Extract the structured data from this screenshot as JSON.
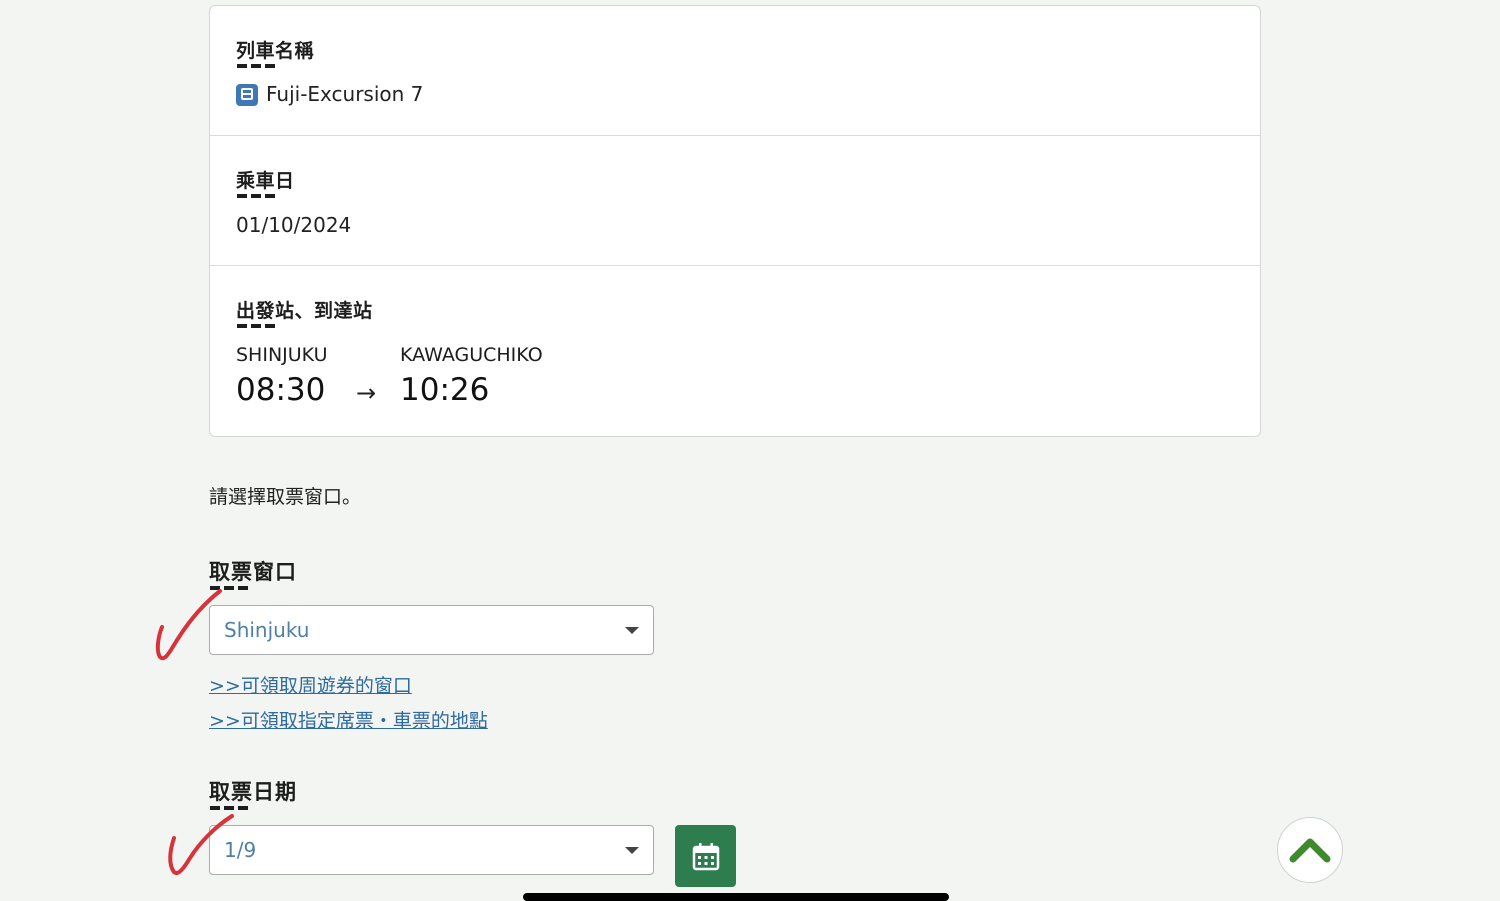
{
  "ticket_card": {
    "train": {
      "label": "列車名稱",
      "name": "Fuji-Excursion 7",
      "icon": "train-icon"
    },
    "date": {
      "label": "乘車日",
      "value": "01/10/2024"
    },
    "route": {
      "label": "出發站、到達站",
      "departure_station": "SHINJUKU",
      "departure_time": "08:30",
      "arrow": "→",
      "arrival_station": "KAWAGUCHIKO",
      "arrival_time": "10:26"
    }
  },
  "instruction": "請選擇取票窗口。",
  "pickup_window": {
    "label": "取票窗口",
    "selected": "Shinjuku"
  },
  "links": [
    ">>可領取周遊券的窗口",
    ">>可領取指定席票・車票的地點"
  ],
  "pickup_date": {
    "label": "取票日期",
    "selected": "1/9",
    "calendar_icon": "calendar-icon"
  },
  "scroll_top_icon": "chevron-up-icon",
  "colors": {
    "background": "#f2f5f2",
    "link": "#2f6aa1",
    "select_text": "#4f7fa6",
    "calendar_button": "#2e7d4f",
    "scroll_top_chevron": "#3e8a2d",
    "checkmark": "#d6333a"
  }
}
